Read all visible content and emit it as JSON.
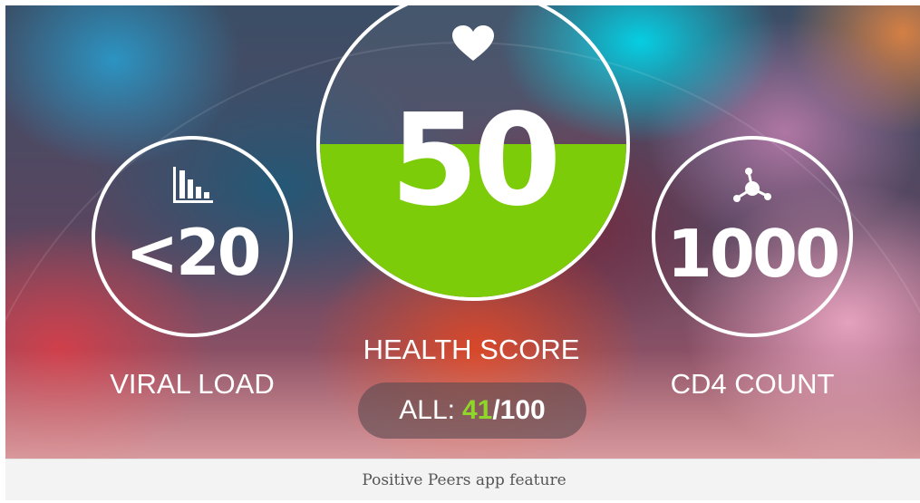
{
  "viral_load": {
    "value": "<20",
    "label": "VIRAL LOAD",
    "icon": "bar-chart-icon"
  },
  "health_score": {
    "value": "50",
    "label": "HEALTH SCORE",
    "icon": "heart-icon",
    "fill_fraction": 0.5,
    "fill_color": "#7ccc0a",
    "all_prefix": "ALL:",
    "all_score": "41",
    "all_total": "/100"
  },
  "cd4_count": {
    "value": "1000",
    "label": "CD4 COUNT",
    "icon": "molecule-icon"
  },
  "caption": "Positive Peers app feature"
}
